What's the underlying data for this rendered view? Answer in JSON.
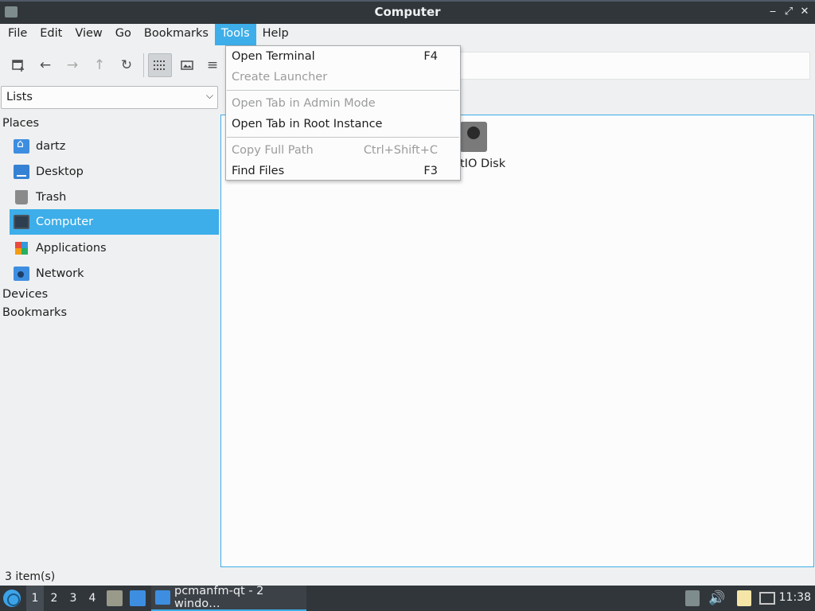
{
  "window": {
    "title": "Computer"
  },
  "menubar": {
    "items": [
      {
        "label": "File"
      },
      {
        "label": "Edit"
      },
      {
        "label": "View"
      },
      {
        "label": "Go"
      },
      {
        "label": "Bookmarks"
      },
      {
        "label": "Tools",
        "active": true
      },
      {
        "label": "Help"
      }
    ]
  },
  "toolbar": {
    "buttons": [
      "new-tab-icon",
      "back-arrow-icon",
      "forward-arrow-icon",
      "up-arrow-icon",
      "reload-icon",
      "icon-view-icon",
      "thumbnail-view-icon",
      "list-view-icon"
    ]
  },
  "sidebar": {
    "combo_value": "Lists",
    "places_heading": "Places",
    "places": [
      {
        "label": "dartz",
        "icon": "home-folder-icon"
      },
      {
        "label": "Desktop",
        "icon": "desktop-icon"
      },
      {
        "label": "Trash",
        "icon": "trash-icon"
      },
      {
        "label": "Computer",
        "icon": "computer-icon",
        "selected": true
      },
      {
        "label": "Applications",
        "icon": "applications-icon"
      },
      {
        "label": "Network",
        "icon": "network-icon"
      }
    ],
    "devices_heading": "Devices",
    "bookmarks_heading": "Bookmarks"
  },
  "content": {
    "items": [
      {
        "label": "tIO Disk",
        "icon": "disk-icon"
      }
    ]
  },
  "status": {
    "text": "3 item(s)"
  },
  "tools_menu": {
    "items": [
      {
        "label": "Open Terminal",
        "shortcut": "F4",
        "enabled": true
      },
      {
        "label": "Create Launcher",
        "shortcut": "",
        "enabled": false
      },
      {
        "label": "Open Tab in Admin Mode",
        "shortcut": "",
        "enabled": false
      },
      {
        "label": "Open Tab in Root Instance",
        "shortcut": "",
        "enabled": true
      },
      {
        "label": "Copy Full Path",
        "shortcut": "Ctrl+Shift+C",
        "enabled": false
      },
      {
        "label": "Find Files",
        "shortcut": "F3",
        "enabled": true
      }
    ]
  },
  "taskbar": {
    "desktops": [
      "1",
      "2",
      "3",
      "4"
    ],
    "task_label": "pcmanfm-qt - 2 windo…",
    "clock": "11:38"
  },
  "colors": {
    "accent": "#3daee9",
    "titlebar": "#31363b",
    "window_bg": "#eff0f1"
  }
}
